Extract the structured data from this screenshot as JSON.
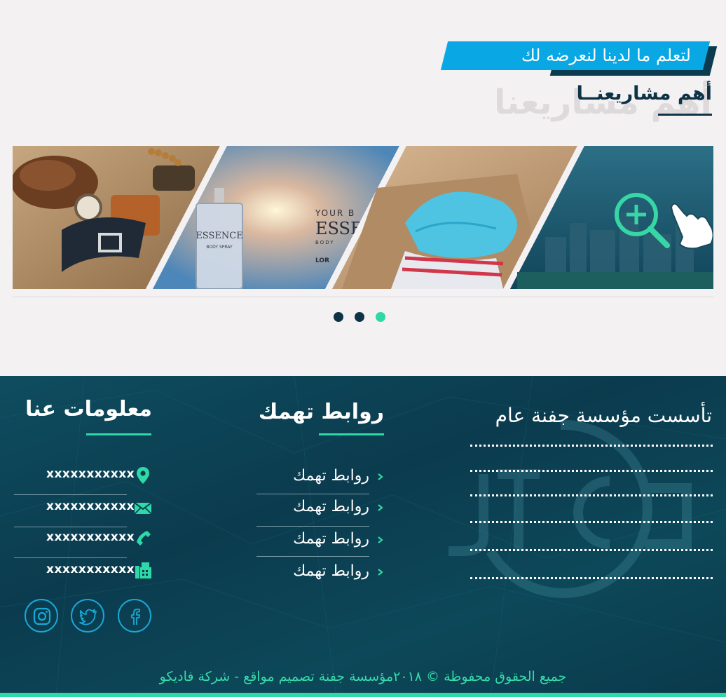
{
  "projects": {
    "banner_text": "لتعلم ما لدينا لنعرضه لك",
    "title": "أهم مشاريعنــا",
    "ghost_title": "أهم مشاريعنا",
    "slider": {
      "dots": 3,
      "active_dot": 3,
      "slide_texts": {
        "bottle_brand": "ESSENCE",
        "bottle_sub": "BODY SPRAY",
        "ad_line1": "YOUR B",
        "ad_line2": "ESSE",
        "ad_line3": "BODY",
        "ad_line4": "LOR"
      }
    }
  },
  "footer": {
    "about": {
      "title": "تأسست مؤسسة جفنة عام",
      "dotted_lines": 6
    },
    "links": {
      "title": "روابط تهمك",
      "items": [
        "روابط تهمك",
        "روابط تهمك",
        "روابط تهمك",
        "روابط تهمك"
      ]
    },
    "info": {
      "title": "معلومات عنا",
      "items": [
        {
          "icon": "location-pin-icon",
          "text": "xxxxxxxxxxx"
        },
        {
          "icon": "envelope-icon",
          "text": "xxxxxxxxxxx"
        },
        {
          "icon": "phone-icon",
          "text": "xxxxxxxxxxx"
        },
        {
          "icon": "fax-icon",
          "text": "xxxxxxxxxxx"
        }
      ]
    },
    "social": [
      "instagram-icon",
      "twitter-icon",
      "facebook-icon"
    ],
    "copyright": "جميع الحقوق محفوظة © ٢٠١٨مؤسسة جفنة تصميم مواقع - شركة فاديكو"
  },
  "colors": {
    "accent_blue": "#09a8e4",
    "navy": "#0e3347",
    "footer_bg": "#0b3b4e",
    "green": "#2fd9a7"
  }
}
